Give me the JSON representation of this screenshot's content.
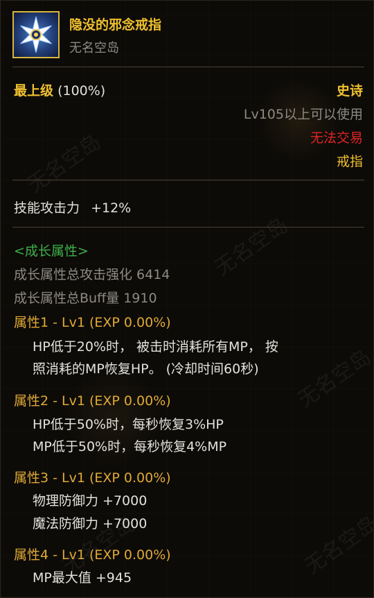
{
  "item": {
    "name": "隐没的邪念戒指",
    "origin": "无名空岛",
    "icon": "star-flower-ring-icon"
  },
  "grade": {
    "label": "最上级",
    "percent": "(100%)"
  },
  "rarity": "史诗",
  "level_req": "Lv105以上可以使用",
  "trade": "无法交易",
  "slot": "戒指",
  "stat": {
    "name": "技能攻击力",
    "value": "+12%"
  },
  "growth": {
    "header": "<成长属性>",
    "attack_total": "成长属性总攻击强化 6414",
    "buff_total": "成长属性总Buff量 1910",
    "attributes": [
      {
        "title": "属性1 - Lv1 (EXP 0.00%)",
        "lines": [
          "HP低于20%时， 被击时消耗所有MP， 按",
          "照消耗的MP恢复HP。 (冷却时间60秒)"
        ]
      },
      {
        "title": "属性2 - Lv1 (EXP 0.00%)",
        "lines": [
          "HP低于50%时，每秒恢复3%HP",
          "MP低于50%时，每秒恢复4%MP"
        ]
      },
      {
        "title": "属性3 - Lv1 (EXP 0.00%)",
        "lines": [
          "物理防御力 +7000",
          "魔法防御力 +7000"
        ]
      },
      {
        "title": "属性4 - Lv1 (EXP 0.00%)",
        "lines": [
          "MP最大值 +945"
        ]
      }
    ]
  },
  "colors": {
    "title_gold": "#f0c02f",
    "attr_orange": "#e1aa35",
    "trade_red": "#e02424",
    "growth_green": "#3fb04a",
    "muted_gray": "#8d8a83"
  }
}
